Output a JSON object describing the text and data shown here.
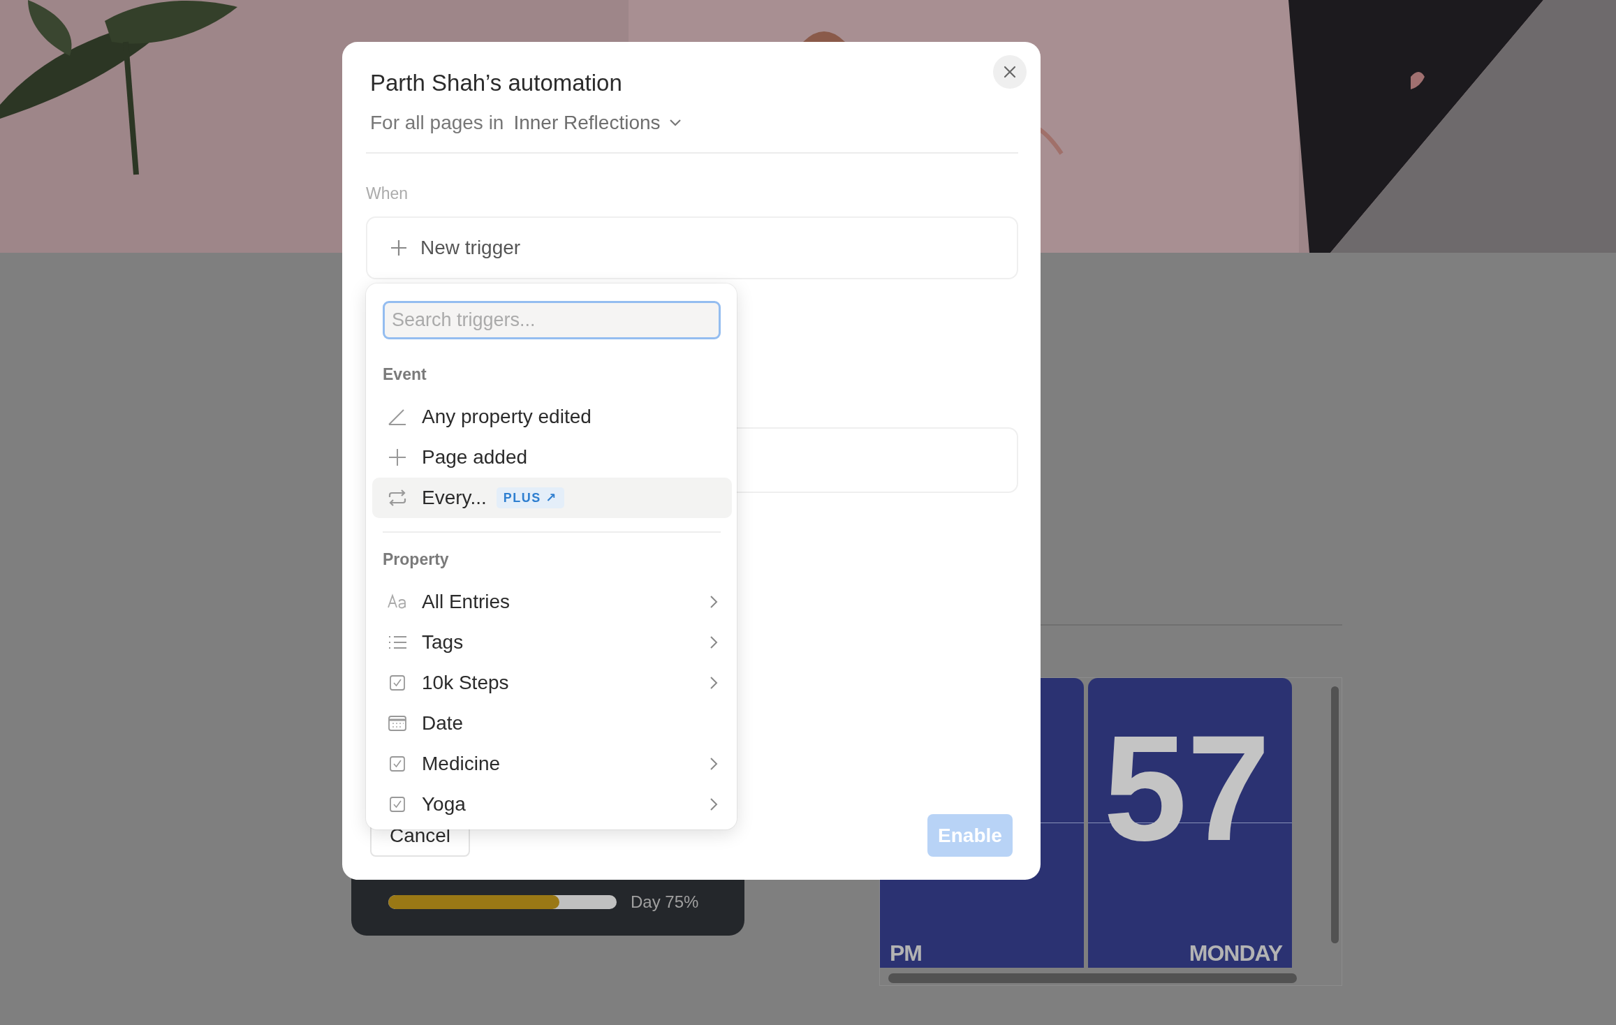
{
  "background": {
    "progress": {
      "level": 0.75,
      "label": "Day 75%"
    },
    "clock": {
      "minutes": "57",
      "period": "PM",
      "day": "MONDAY"
    }
  },
  "dialog": {
    "title": "Parth Shah’s automation",
    "scope_prefix": "For all pages in",
    "scope": "Inner Reflections",
    "when_label": "When",
    "new_trigger": "New trigger",
    "cancel": "Cancel",
    "enable": {
      "label": "Enable",
      "disabled": true
    }
  },
  "trigger_menu": {
    "search": {
      "placeholder": "Search triggers..."
    },
    "sections": [
      {
        "heading": "Event",
        "items": [
          {
            "kind": "pencil",
            "label": "Any property edited",
            "selected": false,
            "submenu": false
          },
          {
            "kind": "plus",
            "label": "Page added",
            "selected": false,
            "submenu": false
          },
          {
            "kind": "repeat",
            "label": "Every...",
            "badge": "PLUS ↗",
            "selected": true,
            "submenu": false
          }
        ]
      },
      {
        "heading": "Property",
        "items": [
          {
            "kind": "text",
            "label": "All Entries",
            "selected": false,
            "submenu": true
          },
          {
            "kind": "list",
            "label": "Tags",
            "selected": false,
            "submenu": true
          },
          {
            "kind": "checkbox",
            "label": "10k Steps",
            "selected": false,
            "submenu": true
          },
          {
            "kind": "calendar",
            "label": "Date",
            "selected": false,
            "submenu": false
          },
          {
            "kind": "checkbox",
            "label": "Medicine",
            "selected": false,
            "submenu": true
          },
          {
            "kind": "checkbox",
            "label": "Yoga",
            "selected": false,
            "submenu": true
          }
        ]
      }
    ]
  }
}
